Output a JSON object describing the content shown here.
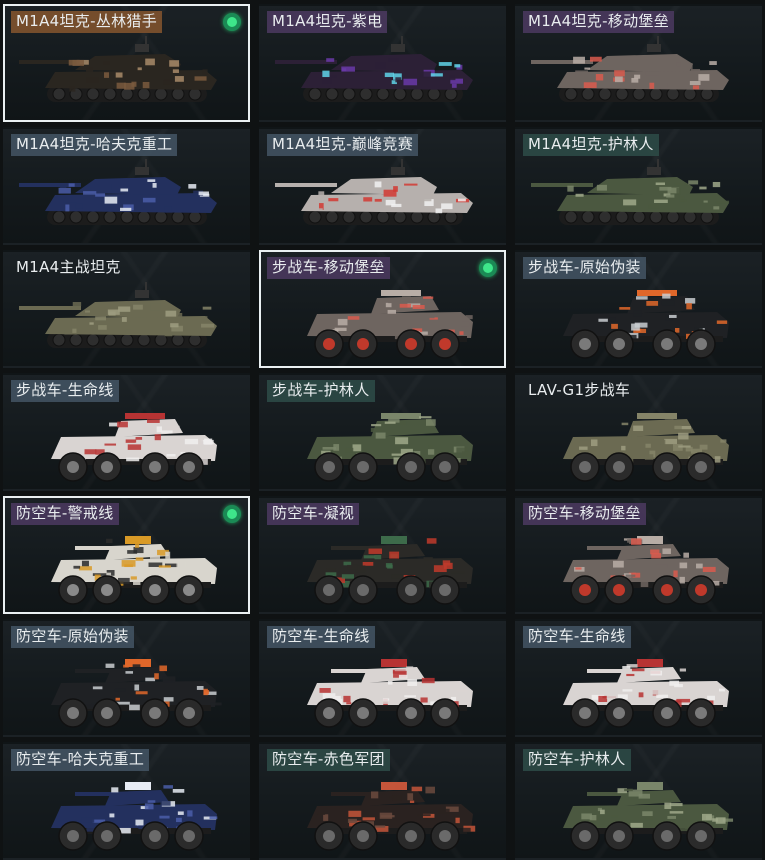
{
  "cards": [
    {
      "label": "M1A4坦克-丛林猎手",
      "type": "tank",
      "camo": "jungle",
      "selected": true,
      "equipped": true,
      "tag": "orange"
    },
    {
      "label": "M1A4坦克-紫电",
      "type": "tank",
      "camo": "purple",
      "selected": false,
      "equipped": false,
      "tag": "purple"
    },
    {
      "label": "M1A4坦克-移动堡垒",
      "type": "tank",
      "camo": "fortress",
      "selected": false,
      "equipped": false,
      "tag": "purple"
    },
    {
      "label": "M1A4坦克-哈夫克重工",
      "type": "tank",
      "camo": "havoc",
      "selected": false,
      "equipped": false,
      "tag": "tinted"
    },
    {
      "label": "M1A4坦克-巅峰竞赛",
      "type": "tank",
      "camo": "racing",
      "selected": false,
      "equipped": false,
      "tag": "tinted"
    },
    {
      "label": "M1A4坦克-护林人",
      "type": "tank",
      "camo": "ranger",
      "selected": false,
      "equipped": false,
      "tag": "teal"
    },
    {
      "label": "M1A4主战坦克",
      "type": "tank",
      "camo": "default",
      "selected": false,
      "equipped": false,
      "tag": "bare"
    },
    {
      "label": "步战车-移动堡垒",
      "type": "ifv",
      "camo": "fortress",
      "selected": true,
      "equipped": true,
      "tag": "purple"
    },
    {
      "label": "步战车-原始伪装",
      "type": "ifv",
      "camo": "primal",
      "selected": false,
      "equipped": false,
      "tag": "tinted"
    },
    {
      "label": "步战车-生命线",
      "type": "ifv",
      "camo": "lifeline",
      "selected": false,
      "equipped": false,
      "tag": "tinted"
    },
    {
      "label": "步战车-护林人",
      "type": "ifv",
      "camo": "ranger",
      "selected": false,
      "equipped": false,
      "tag": "teal"
    },
    {
      "label": "LAV-G1步战车",
      "type": "ifv",
      "camo": "default",
      "selected": false,
      "equipped": false,
      "tag": "bare"
    },
    {
      "label": "防空车-警戒线",
      "type": "aa",
      "camo": "caution",
      "selected": true,
      "equipped": true,
      "tag": "purple"
    },
    {
      "label": "防空车-凝视",
      "type": "aa",
      "camo": "gaze",
      "selected": false,
      "equipped": false,
      "tag": "purple"
    },
    {
      "label": "防空车-移动堡垒",
      "type": "aa",
      "camo": "fortress",
      "selected": false,
      "equipped": false,
      "tag": "purple"
    },
    {
      "label": "防空车-原始伪装",
      "type": "aa",
      "camo": "primal",
      "selected": false,
      "equipped": false,
      "tag": "tinted"
    },
    {
      "label": "防空车-生命线",
      "type": "aa",
      "camo": "lifeline",
      "selected": false,
      "equipped": false,
      "tag": "tinted"
    },
    {
      "label": "防空车-生命线",
      "type": "aa",
      "camo": "lifeline",
      "selected": false,
      "equipped": false,
      "tag": "tinted"
    },
    {
      "label": "防空车-哈夫克重工",
      "type": "aa",
      "camo": "havoc",
      "selected": false,
      "equipped": false,
      "tag": "tinted"
    },
    {
      "label": "防空车-赤色军团",
      "type": "aa",
      "camo": "redlegion",
      "selected": false,
      "equipped": false,
      "tag": "teal"
    },
    {
      "label": "防空车-护林人",
      "type": "aa",
      "camo": "ranger",
      "selected": false,
      "equipped": false,
      "tag": "teal"
    }
  ],
  "palettes": {
    "jungle": {
      "hull": "#2a2620",
      "accent": "#7a5a3e",
      "accent2": "#a88b6a",
      "wheels": "#2b2b2b",
      "hub": "#5a5a5a"
    },
    "purple": {
      "hull": "#2c2036",
      "accent": "#6a3aa8",
      "accent2": "#5fd3e8",
      "wheels": "#262626",
      "hub": "#5a5a5a"
    },
    "fortress": {
      "hull": "#6e6560",
      "accent": "#b8ada6",
      "accent2": "#d95a4e",
      "wheels": "#2b2b2b",
      "hub": "#c0392b"
    },
    "havoc": {
      "hull": "#23305e",
      "accent": "#e8ecf5",
      "accent2": "#4a5da8",
      "wheels": "#2b2b2b",
      "hub": "#6a6a6a"
    },
    "racing": {
      "hull": "#b6b0ad",
      "accent": "#d23a32",
      "accent2": "#f1f1f1",
      "wheels": "#2b2b2b",
      "hub": "#6a6a6a"
    },
    "ranger": {
      "hull": "#4b5840",
      "accent": "#7a866a",
      "accent2": "#9fa88a",
      "wheels": "#2b2b2b",
      "hub": "#6a6a6a"
    },
    "default": {
      "hull": "#6b6a52",
      "accent": "#858468",
      "accent2": "#9d9c80",
      "wheels": "#2b2b2b",
      "hub": "#6a6a6a"
    },
    "primal": {
      "hull": "#1f2124",
      "accent": "#e0672a",
      "accent2": "#c9ccd0",
      "wheels": "#2a2a2a",
      "hub": "#7a7a7a"
    },
    "lifeline": {
      "hull": "#d9d4d2",
      "accent": "#b73333",
      "accent2": "#f0eeee",
      "wheels": "#2a2a2a",
      "hub": "#7a7a7a"
    },
    "caution": {
      "hull": "#d8d5cd",
      "accent": "#d99a27",
      "accent2": "#2b2b2b",
      "wheels": "#2a2a2a",
      "hub": "#8a8a8a"
    },
    "gaze": {
      "hull": "#2b2a27",
      "accent": "#3d6b4a",
      "accent2": "#c0392b",
      "wheels": "#2a2a2a",
      "hub": "#6a6a6a"
    },
    "redlegion": {
      "hull": "#2a2220",
      "accent": "#c4553a",
      "accent2": "#6b4a3e",
      "wheels": "#2a2a2a",
      "hub": "#6a6a6a"
    }
  }
}
